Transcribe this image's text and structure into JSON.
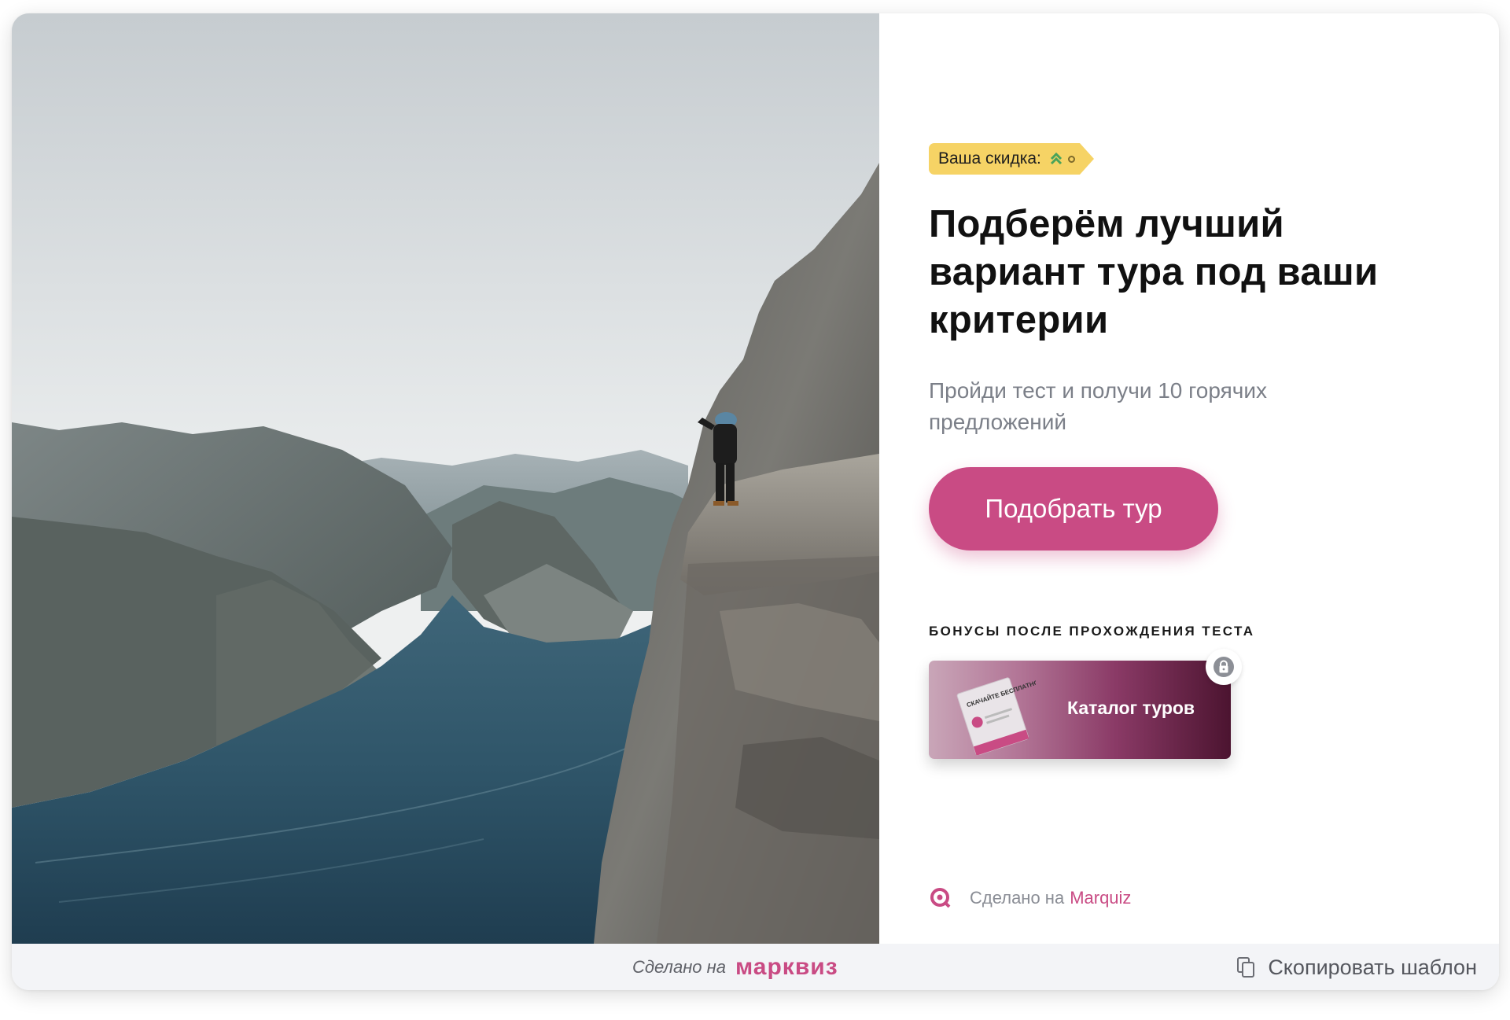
{
  "discount_badge": {
    "label": "Ваша скидка:",
    "icon": "double-chevron-up-icon"
  },
  "hero": {
    "title": "Подберём лучший вариант тура под ваши критерии",
    "subtitle": "Пройди тест и получи 10 горячих предложений",
    "cta_label": "Подобрать тур"
  },
  "bonuses": {
    "heading": "БОНУСЫ ПОСЛЕ ПРОХОЖДЕНИЯ ТЕСТА",
    "items": [
      {
        "label": "Каталог туров",
        "cover_text": "СКАЧАЙТЕ БЕСПЛАТНО",
        "locked": true,
        "icon": "lock-icon"
      }
    ]
  },
  "attribution": {
    "prefix": "Сделано на",
    "link": "Marquiz"
  },
  "bottom_bar": {
    "made_prefix": "Сделано на",
    "brand": "марквиз",
    "copy_label": "Скопировать шаблон",
    "copy_icon": "copy-icon"
  },
  "colors": {
    "accent": "#c94b84",
    "badge": "#f6d365",
    "text": "#111111",
    "muted": "#7b7f88",
    "bar": "#f3f4f7"
  }
}
